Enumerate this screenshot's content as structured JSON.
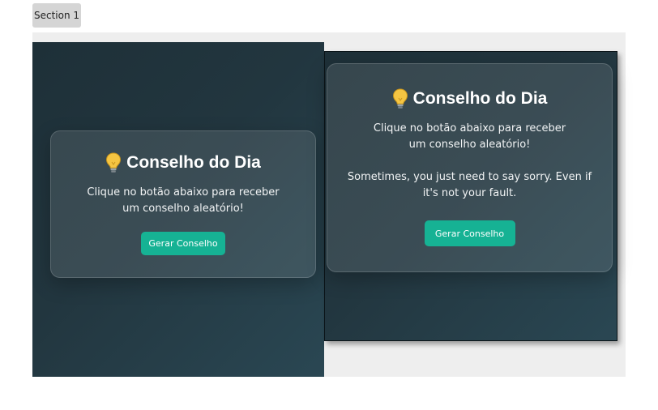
{
  "section_tab": {
    "label": "Section 1"
  },
  "left_card": {
    "title": "Conselho do Dia",
    "icon": "lightbulb-icon",
    "subtitle": "Clique no botão abaixo para receber um conselho aleatório!",
    "button_label": "Gerar Conselho"
  },
  "right_card": {
    "title": "Conselho do Dia",
    "icon": "lightbulb-icon",
    "subtitle": "Clique no botão abaixo para receber um conselho aleatório!",
    "advice": "Sometimes, you just need to say sorry. Even if it's not your fault.",
    "button_label": "Gerar Conselho"
  },
  "colors": {
    "accent": "#16b294",
    "panel_dark": "#22363f",
    "bulb": "#f5c542"
  }
}
